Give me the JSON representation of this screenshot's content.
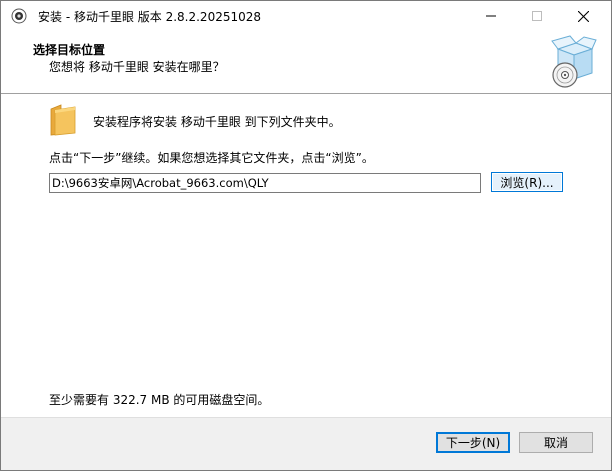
{
  "window": {
    "title": "安装 - 移动千里眼 版本 2.8.2.20251028",
    "controls": {
      "minimize_icon": "minimize-icon",
      "maximize_icon": "maximize-icon",
      "close_icon": "close-icon"
    }
  },
  "header": {
    "title": "选择目标位置",
    "subtitle": "您想将 移动千里眼 安装在哪里？",
    "icon": "install-box-disc-icon"
  },
  "content": {
    "intro": "安装程序将安装 移动千里眼 到下列文件夹中。",
    "instruction": "点击“下一步”继续。如果您想选择其它文件夹，点击“浏览”。",
    "path_value": "D:\\9663安卓网\\Acrobat_9663.com\\QLY",
    "browse_label": "浏览(R)...",
    "disk_space": "至少需要有 322.7 MB 的可用磁盘空间。"
  },
  "footer": {
    "next_label": "下一步(N)",
    "cancel_label": "取消"
  },
  "colors": {
    "accent": "#0078d7",
    "footer_bg": "#f0f0f0",
    "folder": "#f5c45e"
  }
}
